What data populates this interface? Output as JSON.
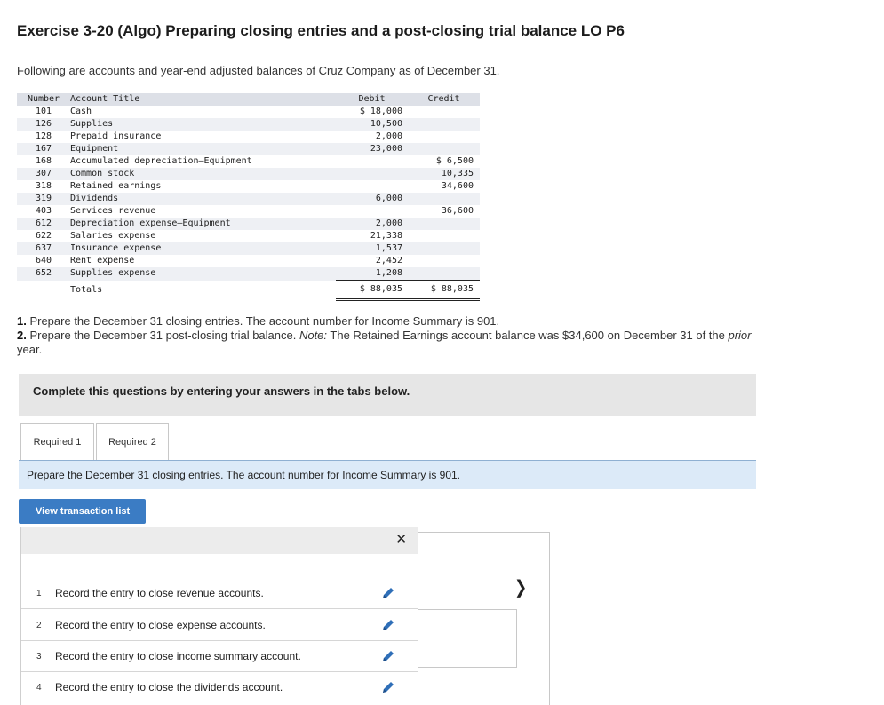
{
  "title": "Exercise 3-20 (Algo) Preparing closing entries and a post-closing trial balance LO P6",
  "intro": "Following are accounts and year-end adjusted balances of Cruz Company as of December 31.",
  "table": {
    "headers": {
      "number": "Number",
      "title": "Account Title",
      "debit": "Debit",
      "credit": "Credit"
    },
    "rows": [
      {
        "number": "101",
        "title": "Cash",
        "debit": "$ 18,000",
        "credit": ""
      },
      {
        "number": "126",
        "title": "Supplies",
        "debit": "10,500",
        "credit": ""
      },
      {
        "number": "128",
        "title": "Prepaid insurance",
        "debit": "2,000",
        "credit": ""
      },
      {
        "number": "167",
        "title": "Equipment",
        "debit": "23,000",
        "credit": ""
      },
      {
        "number": "168",
        "title": "Accumulated depreciation—Equipment",
        "debit": "",
        "credit": "$ 6,500"
      },
      {
        "number": "307",
        "title": "Common stock",
        "debit": "",
        "credit": "10,335"
      },
      {
        "number": "318",
        "title": "Retained earnings",
        "debit": "",
        "credit": "34,600"
      },
      {
        "number": "319",
        "title": "Dividends",
        "debit": "6,000",
        "credit": ""
      },
      {
        "number": "403",
        "title": "Services revenue",
        "debit": "",
        "credit": "36,600"
      },
      {
        "number": "612",
        "title": "Depreciation expense—Equipment",
        "debit": "2,000",
        "credit": ""
      },
      {
        "number": "622",
        "title": "Salaries expense",
        "debit": "21,338",
        "credit": ""
      },
      {
        "number": "637",
        "title": "Insurance expense",
        "debit": "1,537",
        "credit": ""
      },
      {
        "number": "640",
        "title": "Rent expense",
        "debit": "2,452",
        "credit": ""
      },
      {
        "number": "652",
        "title": "Supplies expense",
        "debit": "1,208",
        "credit": ""
      }
    ],
    "totals": {
      "label": "Totals",
      "debit": "$ 88,035",
      "credit": "$ 88,035"
    }
  },
  "instructions": {
    "item1_num": "1.",
    "item1": " Prepare the December 31 closing entries. The account number for Income Summary is 901.",
    "item2_num": "2.",
    "item2_a": " Prepare the December 31 post-closing trial balance. ",
    "item2_note": "Note:",
    "item2_b": " The Retained Earnings account balance was $34,600 on December 31 of the ",
    "item2_prior": "prior",
    "item2_c": " year."
  },
  "banner": "Complete this questions by entering your answers in the tabs below.",
  "tabs": [
    "Required 1",
    "Required 2"
  ],
  "prompt": "Prepare the December 31 closing entries. The account number for Income Summary is 901.",
  "view_button": "View transaction list",
  "entries": [
    {
      "num": "1",
      "text": "Record the entry to close revenue accounts."
    },
    {
      "num": "2",
      "text": "Record the entry to close expense accounts."
    },
    {
      "num": "3",
      "text": "Record the entry to close income summary account."
    },
    {
      "num": "4",
      "text": "Record the entry to close the dividends account."
    }
  ],
  "icons": {
    "close": "close-icon",
    "edit": "pencil-icon",
    "next": "chevron-right-icon"
  },
  "colors": {
    "button": "#3b7cc4",
    "prompt_bar": "#dceaf8",
    "banner": "#e6e6e6",
    "pencil": "#2f6fb8"
  }
}
